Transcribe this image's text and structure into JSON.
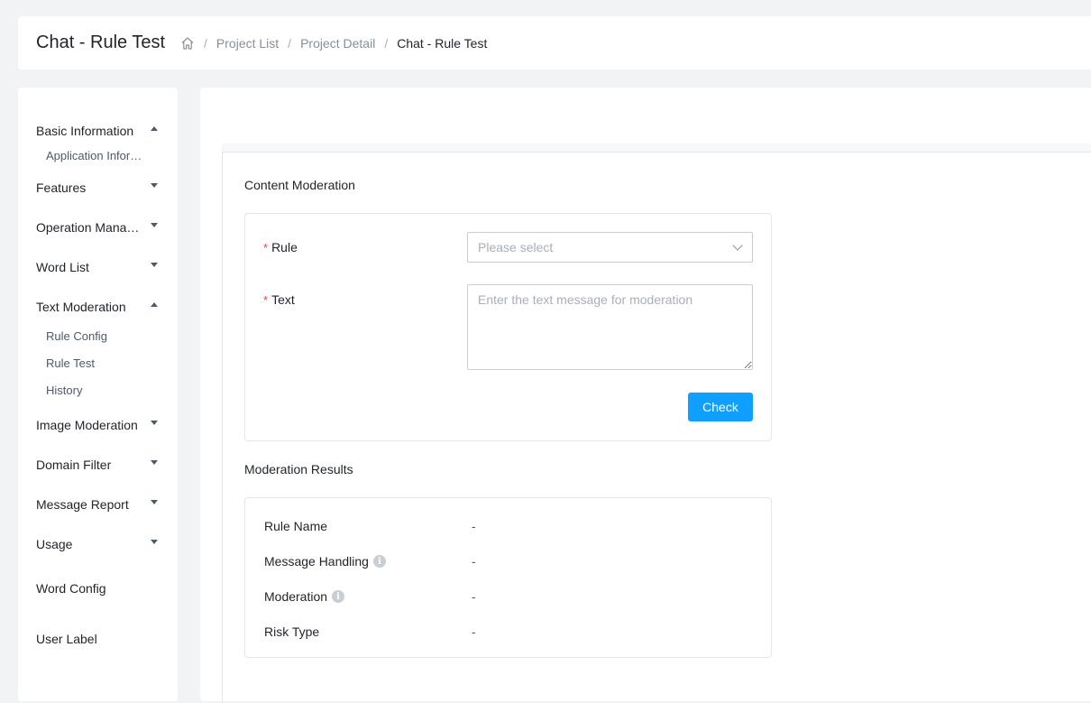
{
  "header": {
    "title": "Chat - Rule Test",
    "home_icon": "home-icon",
    "breadcrumb": {
      "sep": "/",
      "items": [
        "Project List",
        "Project Detail",
        "Chat - Rule Test"
      ]
    }
  },
  "sidebar": {
    "groups": [
      {
        "label": "Basic Information",
        "expanded": true,
        "children": [
          "Application Information"
        ]
      },
      {
        "label": "Features",
        "expanded": false
      },
      {
        "label": "Operation Management",
        "expanded": false
      },
      {
        "label": "Word List",
        "expanded": false
      },
      {
        "label": "Text Moderation",
        "expanded": true,
        "children": [
          "Rule Config",
          "Rule Test",
          "History"
        ]
      },
      {
        "label": "Image Moderation",
        "expanded": false
      },
      {
        "label": "Domain Filter",
        "expanded": false
      },
      {
        "label": "Message Report",
        "expanded": false
      },
      {
        "label": "Usage",
        "expanded": false
      },
      {
        "label": "Word Config"
      },
      {
        "label": "User Label"
      }
    ]
  },
  "content_moderation": {
    "title": "Content Moderation",
    "rule_label": "Rule",
    "rule_placeholder": "Please select",
    "text_label": "Text",
    "text_placeholder": "Enter the text message for moderation",
    "required_mark": "*",
    "check_button": "Check"
  },
  "results": {
    "title": "Moderation Results",
    "rows": [
      {
        "label": "Rule Name",
        "value": "-"
      },
      {
        "label": "Message Handling",
        "value": "-",
        "info": "i"
      },
      {
        "label": "Moderation",
        "value": "-",
        "info": "i"
      },
      {
        "label": "Risk Type",
        "value": "-"
      }
    ]
  },
  "colors": {
    "primary": "#0fa0ff",
    "required": "#f53f3f",
    "background": "#f2f3f5"
  }
}
